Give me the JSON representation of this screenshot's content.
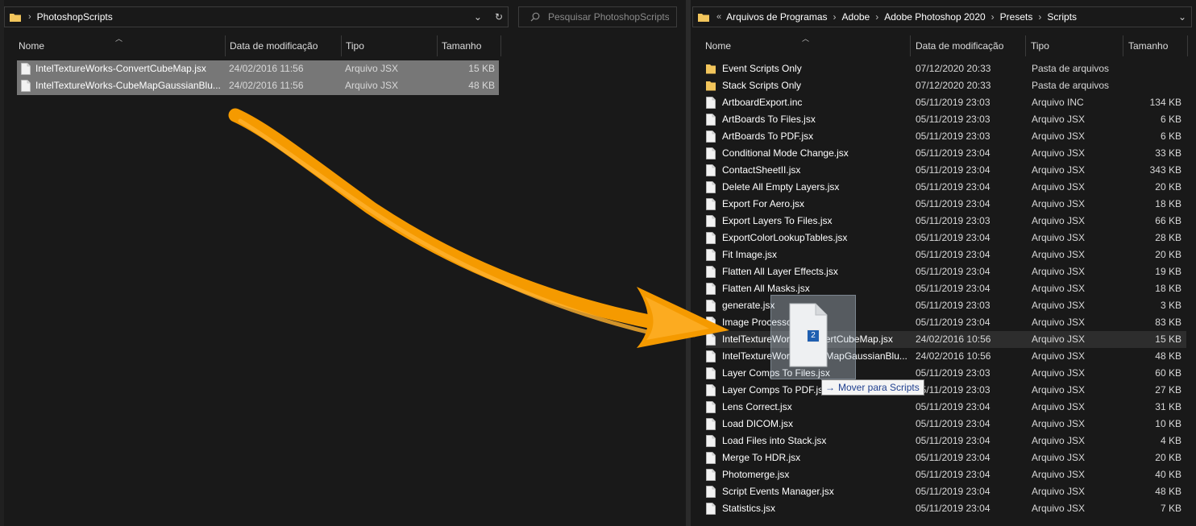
{
  "left_window": {
    "breadcrumb": [
      "PhotoshopScripts"
    ],
    "search_placeholder": "Pesquisar PhotoshopScripts",
    "columns": {
      "name": "Nome",
      "date": "Data de modificação",
      "type": "Tipo",
      "size": "Tamanho"
    },
    "files": [
      {
        "name": "IntelTextureWorks-ConvertCubeMap.jsx",
        "date": "24/02/2016 11:56",
        "type": "Arquivo JSX",
        "size": "15 KB",
        "icon": "document-icon",
        "selected": true
      },
      {
        "name": "IntelTextureWorks-CubeMapGaussianBlu...",
        "date": "24/02/2016 11:56",
        "type": "Arquivo JSX",
        "size": "48 KB",
        "icon": "document-icon",
        "selected": true
      }
    ]
  },
  "right_window": {
    "breadcrumb": [
      "Arquivos de Programas",
      "Adobe",
      "Adobe Photoshop 2020",
      "Presets",
      "Scripts"
    ],
    "overflow_glyph": "«",
    "columns": {
      "name": "Nome",
      "date": "Data de modificação",
      "type": "Tipo",
      "size": "Tamanho"
    },
    "files": [
      {
        "name": "Event Scripts Only",
        "date": "07/12/2020 20:33",
        "type": "Pasta de arquivos",
        "size": "",
        "icon": "folder-icon"
      },
      {
        "name": "Stack Scripts Only",
        "date": "07/12/2020 20:33",
        "type": "Pasta de arquivos",
        "size": "",
        "icon": "folder-icon"
      },
      {
        "name": "ArtboardExport.inc",
        "date": "05/11/2019 23:03",
        "type": "Arquivo INC",
        "size": "134 KB",
        "icon": "document-icon"
      },
      {
        "name": "ArtBoards To Files.jsx",
        "date": "05/11/2019 23:03",
        "type": "Arquivo JSX",
        "size": "6 KB",
        "icon": "document-icon"
      },
      {
        "name": "ArtBoards To PDF.jsx",
        "date": "05/11/2019 23:03",
        "type": "Arquivo JSX",
        "size": "6 KB",
        "icon": "document-icon"
      },
      {
        "name": "Conditional Mode Change.jsx",
        "date": "05/11/2019 23:04",
        "type": "Arquivo JSX",
        "size": "33 KB",
        "icon": "document-icon"
      },
      {
        "name": "ContactSheetII.jsx",
        "date": "05/11/2019 23:04",
        "type": "Arquivo JSX",
        "size": "343 KB",
        "icon": "document-icon"
      },
      {
        "name": "Delete All Empty Layers.jsx",
        "date": "05/11/2019 23:04",
        "type": "Arquivo JSX",
        "size": "20 KB",
        "icon": "document-icon"
      },
      {
        "name": "Export For Aero.jsx",
        "date": "05/11/2019 23:04",
        "type": "Arquivo JSX",
        "size": "18 KB",
        "icon": "document-icon"
      },
      {
        "name": "Export Layers To Files.jsx",
        "date": "05/11/2019 23:03",
        "type": "Arquivo JSX",
        "size": "66 KB",
        "icon": "document-icon"
      },
      {
        "name": "ExportColorLookupTables.jsx",
        "date": "05/11/2019 23:04",
        "type": "Arquivo JSX",
        "size": "28 KB",
        "icon": "document-icon"
      },
      {
        "name": "Fit Image.jsx",
        "date": "05/11/2019 23:04",
        "type": "Arquivo JSX",
        "size": "20 KB",
        "icon": "document-icon"
      },
      {
        "name": "Flatten All Layer Effects.jsx",
        "date": "05/11/2019 23:04",
        "type": "Arquivo JSX",
        "size": "19 KB",
        "icon": "document-icon"
      },
      {
        "name": "Flatten All Masks.jsx",
        "date": "05/11/2019 23:04",
        "type": "Arquivo JSX",
        "size": "18 KB",
        "icon": "document-icon"
      },
      {
        "name": "generate.jsx",
        "date": "05/11/2019 23:03",
        "type": "Arquivo JSX",
        "size": "3 KB",
        "icon": "document-icon"
      },
      {
        "name": "Image Processor.jsx",
        "date": "05/11/2019 23:04",
        "type": "Arquivo JSX",
        "size": "83 KB",
        "icon": "document-icon"
      },
      {
        "name": "IntelTextureWorks-ConvertCubeMap.jsx",
        "date": "24/02/2016 10:56",
        "type": "Arquivo JSX",
        "size": "15 KB",
        "icon": "document-icon",
        "hover": true
      },
      {
        "name": "IntelTextureWorks-CubeMapGaussianBlu...",
        "date": "24/02/2016 10:56",
        "type": "Arquivo JSX",
        "size": "48 KB",
        "icon": "document-icon"
      },
      {
        "name": "Layer Comps To Files.jsx",
        "date": "05/11/2019 23:03",
        "type": "Arquivo JSX",
        "size": "60 KB",
        "icon": "document-icon"
      },
      {
        "name": "Layer Comps To PDF.jsx",
        "date": "05/11/2019 23:03",
        "type": "Arquivo JSX",
        "size": "27 KB",
        "icon": "document-icon"
      },
      {
        "name": "Lens Correct.jsx",
        "date": "05/11/2019 23:04",
        "type": "Arquivo JSX",
        "size": "31 KB",
        "icon": "document-icon"
      },
      {
        "name": "Load DICOM.jsx",
        "date": "05/11/2019 23:04",
        "type": "Arquivo JSX",
        "size": "10 KB",
        "icon": "document-icon"
      },
      {
        "name": "Load Files into Stack.jsx",
        "date": "05/11/2019 23:04",
        "type": "Arquivo JSX",
        "size": "4 KB",
        "icon": "document-icon"
      },
      {
        "name": "Merge To HDR.jsx",
        "date": "05/11/2019 23:04",
        "type": "Arquivo JSX",
        "size": "20 KB",
        "icon": "document-icon"
      },
      {
        "name": "Photomerge.jsx",
        "date": "05/11/2019 23:04",
        "type": "Arquivo JSX",
        "size": "40 KB",
        "icon": "document-icon"
      },
      {
        "name": "Script Events Manager.jsx",
        "date": "05/11/2019 23:04",
        "type": "Arquivo JSX",
        "size": "48 KB",
        "icon": "document-icon"
      },
      {
        "name": "Statistics.jsx",
        "date": "05/11/2019 23:04",
        "type": "Arquivo JSX",
        "size": "7 KB",
        "icon": "document-icon"
      }
    ]
  },
  "drag": {
    "count_badge": "2",
    "tooltip": "Mover para Scripts",
    "arrow_color": "#f59a00"
  },
  "colors": {
    "background": "#191919",
    "selection": "#777777",
    "folder": "#f2c55c"
  }
}
